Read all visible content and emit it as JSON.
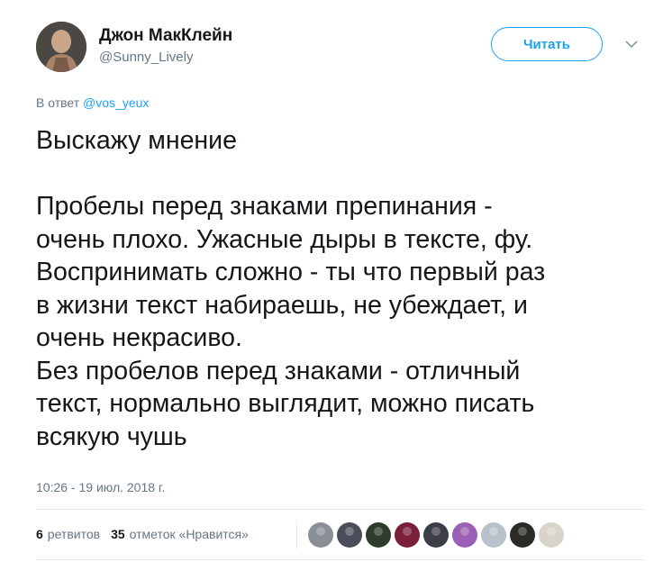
{
  "user": {
    "display_name": "Джон МакКлейн",
    "handle": "@Sunny_Lively"
  },
  "follow_button_label": "Читать",
  "reply": {
    "prefix": "В ответ",
    "to_handle": "@vos_yeux"
  },
  "tweet_lines": [
    "Выскажу мнение",
    "",
    "Пробелы перед знаками препинания -",
    "очень плохо. Ужасные дыры в тексте, фу.",
    "Воспринимать сложно - ты что первый раз",
    "в жизни текст набираешь, не убеждает, и",
    "очень некрасиво.",
    "Без пробелов перед знаками - отличный",
    "текст, нормально выглядит, можно писать",
    "всякую чушь"
  ],
  "timestamp": "10:26 - 19 июл. 2018 г.",
  "stats": {
    "retweets_count": "6",
    "retweets_label": "ретвитов",
    "likes_count": "35",
    "likes_label": "отметок «Нравится»"
  },
  "likers": [
    {
      "name": "liker-avatar-1",
      "color": "#8a8f96"
    },
    {
      "name": "liker-avatar-2",
      "color": "#4a4e5a"
    },
    {
      "name": "liker-avatar-3",
      "color": "#2f3b2c"
    },
    {
      "name": "liker-avatar-4",
      "color": "#7a1f3a"
    },
    {
      "name": "liker-avatar-5",
      "color": "#3c3f46"
    },
    {
      "name": "liker-avatar-6",
      "color": "#9b5fb5"
    },
    {
      "name": "liker-avatar-7",
      "color": "#b9c2cb"
    },
    {
      "name": "liker-avatar-8",
      "color": "#2b2a26"
    },
    {
      "name": "liker-avatar-9",
      "color": "#d8d4cc"
    }
  ],
  "colors": {
    "accent": "#1da1f2",
    "secondary_text": "#657786",
    "primary_text": "#14171a"
  },
  "icons": {
    "caret": "chevron-down-icon"
  }
}
